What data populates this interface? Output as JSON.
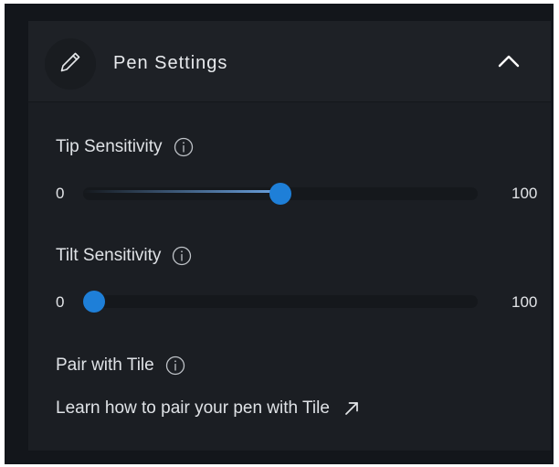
{
  "header": {
    "title": "Pen Settings",
    "icon": "pen-icon",
    "toggle_icon": "chevron-up-icon"
  },
  "tip_sensitivity": {
    "label": "Tip Sensitivity",
    "min": "0",
    "max": "100",
    "value": 50
  },
  "tilt_sensitivity": {
    "label": "Tilt Sensitivity",
    "min": "0",
    "max": "100",
    "value": 0
  },
  "pair": {
    "label": "Pair with Tile",
    "link_text": "Learn how to pair your pen with Tile",
    "link_icon": "external-link-arrow-icon"
  },
  "colors": {
    "accent": "#1e7fd8",
    "background": "#1b1e23",
    "text": "#dfe2e6"
  }
}
